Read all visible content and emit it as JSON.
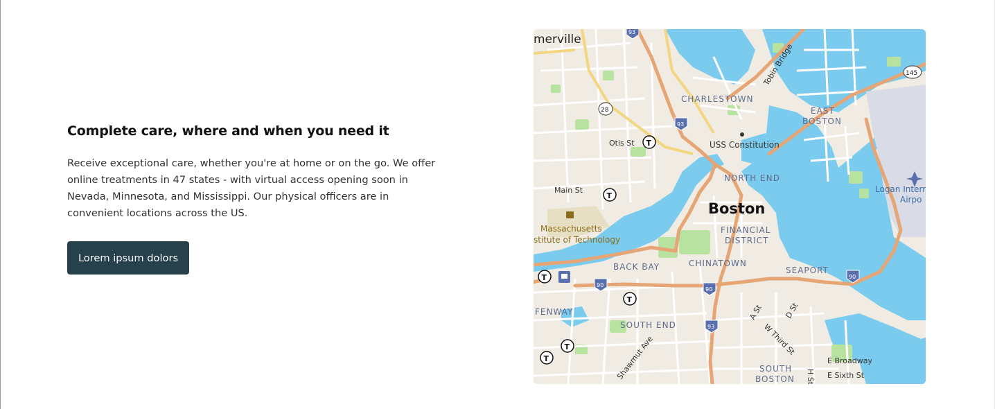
{
  "section": {
    "title": "Complete care, where and when you need it",
    "body": "Receive exceptional care, whether you're at home or on the go. We offer online treatments in 47 states - with virtual access opening soon in Nevada, Minnesota, and Mississippi. Our physical officers are in convenient locations across the US.",
    "cta_label": "Lorem ipsum dolors"
  },
  "map": {
    "city_label": "Boston",
    "neighborhoods": {
      "somerville": "merville",
      "charlestown": "CHARLESTOWN",
      "east_boston_1": "EAST",
      "east_boston_2": "BOSTON",
      "north_end": "NORTH END",
      "financial_1": "FINANCIAL",
      "financial_2": "DISTRICT",
      "back_bay": "BACK BAY",
      "chinatown": "CHINATOWN",
      "seaport": "SEAPORT",
      "fenway": "FENWAY",
      "south_end": "SOUTH END",
      "south_boston_1": "SOUTH",
      "south_boston_2": "BOSTON"
    },
    "places": {
      "uss_constitution": "USS Constitution",
      "mit_1": "Massachusetts",
      "mit_2": "stitute of Technology",
      "airport_1": "Logan Intern",
      "airport_2": "Airpo"
    },
    "streets": {
      "otis": "Otis St",
      "main": "Main St",
      "tobin": "Tobin Bridge",
      "a_st": "A St",
      "d_st": "D St",
      "w_third": "W Third St",
      "shawmut": "Shawmut Ave",
      "e_broadway": "E Broadway",
      "e_sixth": "E Sixth St",
      "h_st": "H St"
    },
    "shields": {
      "i93": "93",
      "i90": "90",
      "rt28": "28",
      "rt145": "145"
    },
    "transit_glyph": "T",
    "colors": {
      "water": "#7bcbee",
      "land": "#f0ece4",
      "park": "#b8e2a0",
      "highway": "#e6a574",
      "major_road": "#f2d681",
      "interstate": "#5a6fae",
      "cta_background": "#27414c"
    }
  }
}
